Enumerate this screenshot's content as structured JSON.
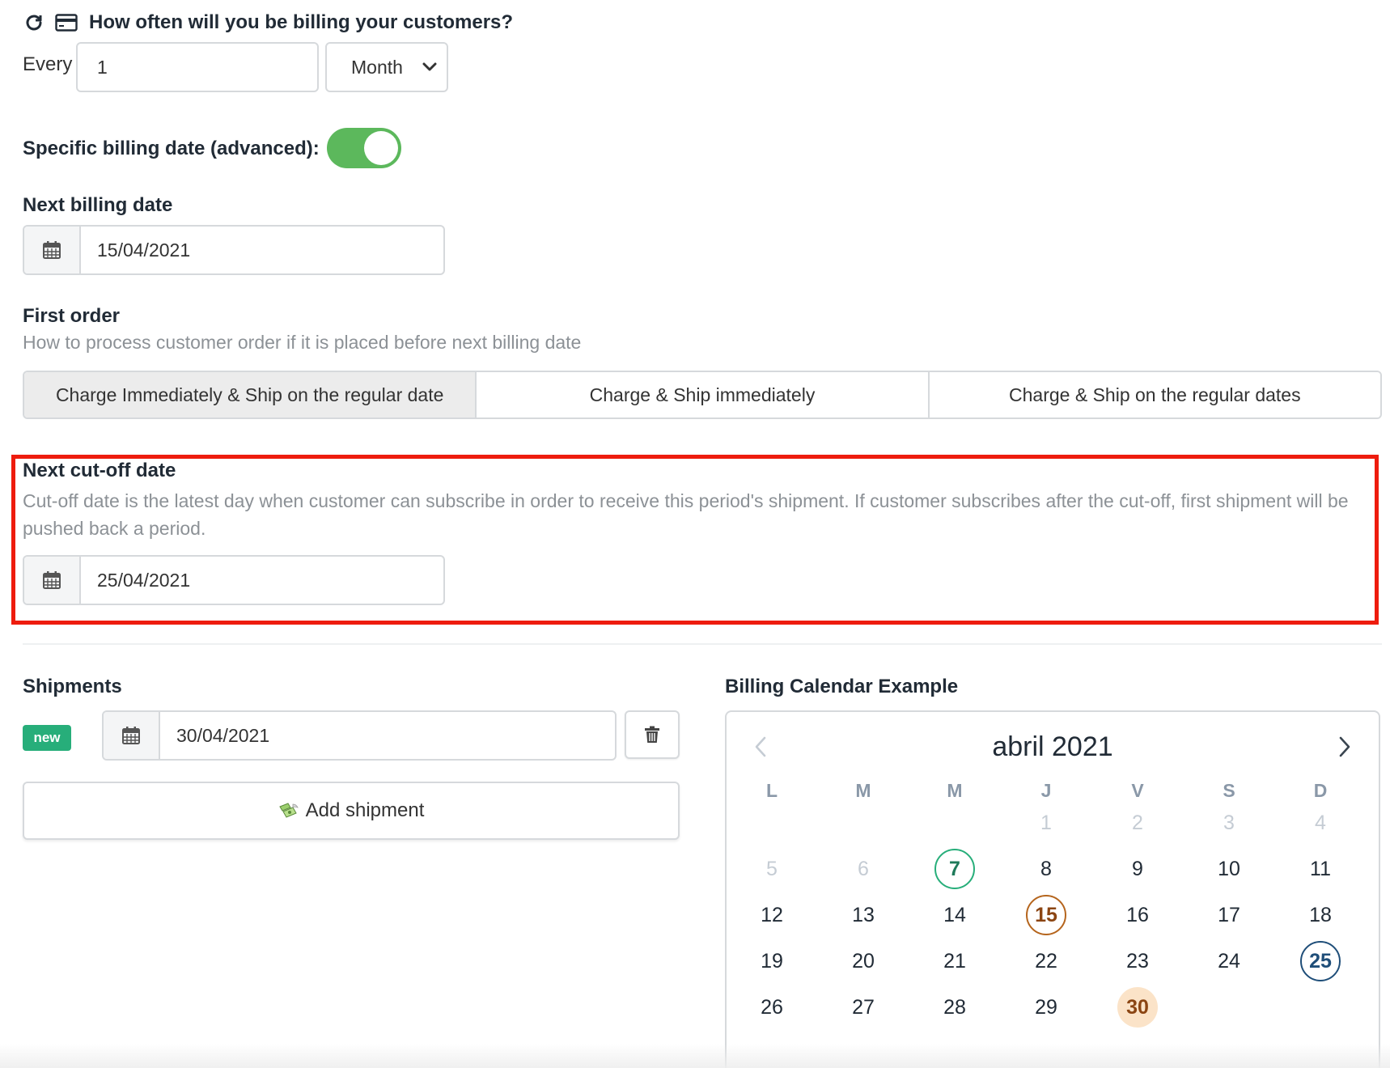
{
  "billing_frequency": {
    "question": "How often will you be billing your customers?",
    "every_label": "Every",
    "interval_value": "1",
    "period_selected": "Month"
  },
  "specific_date": {
    "label": "Specific billing date (advanced):",
    "enabled": true,
    "toggle_color": "#5cb85c"
  },
  "next_billing": {
    "label": "Next billing date",
    "value": "15/04/2021"
  },
  "first_order": {
    "label": "First order",
    "help": "How to process customer order if it is placed before next billing date",
    "options": [
      "Charge Immediately & Ship on the regular date",
      "Charge & Ship immediately",
      "Charge & Ship on the regular dates"
    ],
    "selected_index": 0
  },
  "cutoff": {
    "label": "Next cut-off date",
    "help": "Cut-off date is the latest day when customer can subscribe in order to receive this period's shipment. If customer subscribes after the cut-off, first shipment will be pushed back a period.",
    "value": "25/04/2021"
  },
  "shipments": {
    "label": "Shipments",
    "badge": "new",
    "date_value": "30/04/2021",
    "add_label": "Add shipment"
  },
  "calendar": {
    "title": "Billing Calendar Example",
    "month_label": "abril 2021",
    "weekdays": [
      "L",
      "M",
      "M",
      "J",
      "V",
      "S",
      "D"
    ],
    "weeks": [
      [
        "",
        "",
        "",
        "1",
        "2",
        "3",
        "4"
      ],
      [
        "5",
        "6",
        "7",
        "8",
        "9",
        "10",
        "11"
      ],
      [
        "12",
        "13",
        "14",
        "15",
        "16",
        "17",
        "18"
      ],
      [
        "19",
        "20",
        "21",
        "22",
        "23",
        "24",
        "25"
      ],
      [
        "26",
        "27",
        "28",
        "29",
        "30",
        "",
        ""
      ]
    ],
    "muted_days": [
      "1",
      "2",
      "3",
      "4",
      "5",
      "6"
    ],
    "highlights": {
      "7": "ring-green",
      "15": "ring-brown",
      "25": "ring-blue",
      "30": "fill-peach"
    }
  }
}
